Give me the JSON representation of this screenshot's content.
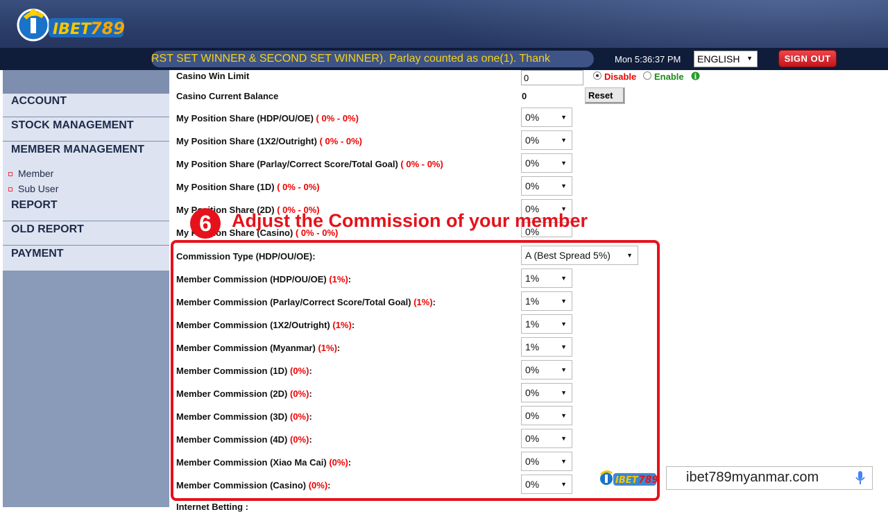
{
  "header": {
    "marquee_text": "RST SET WINNER & SECOND SET WINNER). Parlay counted as one(1). Thank",
    "clock": "Mon 5:36:37 PM",
    "language": "ENGLISH",
    "sign_out_label": "SIGN OUT"
  },
  "sidebar": {
    "items": [
      {
        "label": "ACCOUNT"
      },
      {
        "label": "STOCK MANAGEMENT"
      },
      {
        "label": "MEMBER MANAGEMENT"
      },
      {
        "label": "REPORT"
      },
      {
        "label": "OLD REPORT"
      },
      {
        "label": "PAYMENT"
      }
    ],
    "sub_items": [
      {
        "label": "Member"
      },
      {
        "label": "Sub User"
      }
    ]
  },
  "form": {
    "casino_win_limit": {
      "label": "Casino Win Limit",
      "value": "0",
      "option_disable": "Disable",
      "option_enable": "Enable"
    },
    "casino_balance": {
      "label": "Casino Current Balance",
      "value": "0",
      "reset_label": "Reset"
    },
    "position_shares": [
      {
        "label": "My Position Share (HDP/OU/OE)",
        "range": "( 0% - 0%)",
        "value": "0%"
      },
      {
        "label": "My Position Share (1X2/Outright)",
        "range": "( 0% - 0%)",
        "value": "0%"
      },
      {
        "label": "My Position Share (Parlay/Correct Score/Total Goal)",
        "range": "( 0% - 0%)",
        "value": "0%"
      },
      {
        "label": "My Position Share (1D)",
        "range": "( 0% - 0%)",
        "value": "0%"
      },
      {
        "label": "My Position Share (2D)",
        "range": "( 0% - 0%)",
        "value": "0%"
      },
      {
        "label": "My Position Share (Casino)",
        "range": "( 0% - 0%)",
        "value": "0%"
      }
    ],
    "commission_type": {
      "label": "Commission Type (HDP/OU/OE):",
      "value": "A (Best Spread 5%)"
    },
    "commissions": [
      {
        "label": "Member Commission (HDP/OU/OE)",
        "range": "(1%)",
        "value": "1%"
      },
      {
        "label": "Member Commission (Parlay/Correct Score/Total Goal)",
        "range": "(1%)",
        "value": "1%"
      },
      {
        "label": "Member Commission (1X2/Outright)",
        "range": "(1%)",
        "value": "1%"
      },
      {
        "label": "Member Commission (Myanmar)",
        "range": "(1%)",
        "value": "1%"
      },
      {
        "label": "Member Commission (1D)",
        "range": "(0%)",
        "value": "0%"
      },
      {
        "label": "Member Commission (2D)",
        "range": "(0%)",
        "value": "0%"
      },
      {
        "label": "Member Commission (3D)",
        "range": "(0%)",
        "value": "0%"
      },
      {
        "label": "Member Commission (4D)",
        "range": "(0%)",
        "value": "0%"
      },
      {
        "label": "Member Commission (Xiao Ma Cai)",
        "range": "(0%)",
        "value": "0%"
      },
      {
        "label": "Member Commission (Casino)",
        "range": "(0%)",
        "value": "0%"
      }
    ],
    "internet_betting_label": "Internet Betting :"
  },
  "annotation": {
    "step_number": "6",
    "text": "Adjust the Commission of your member"
  },
  "watermark": {
    "url": "ibet789myanmar.com"
  },
  "colors": {
    "accent_red": "#e5121b",
    "marquee_text": "#f4d21c",
    "header_bg": "#2b3d68"
  }
}
